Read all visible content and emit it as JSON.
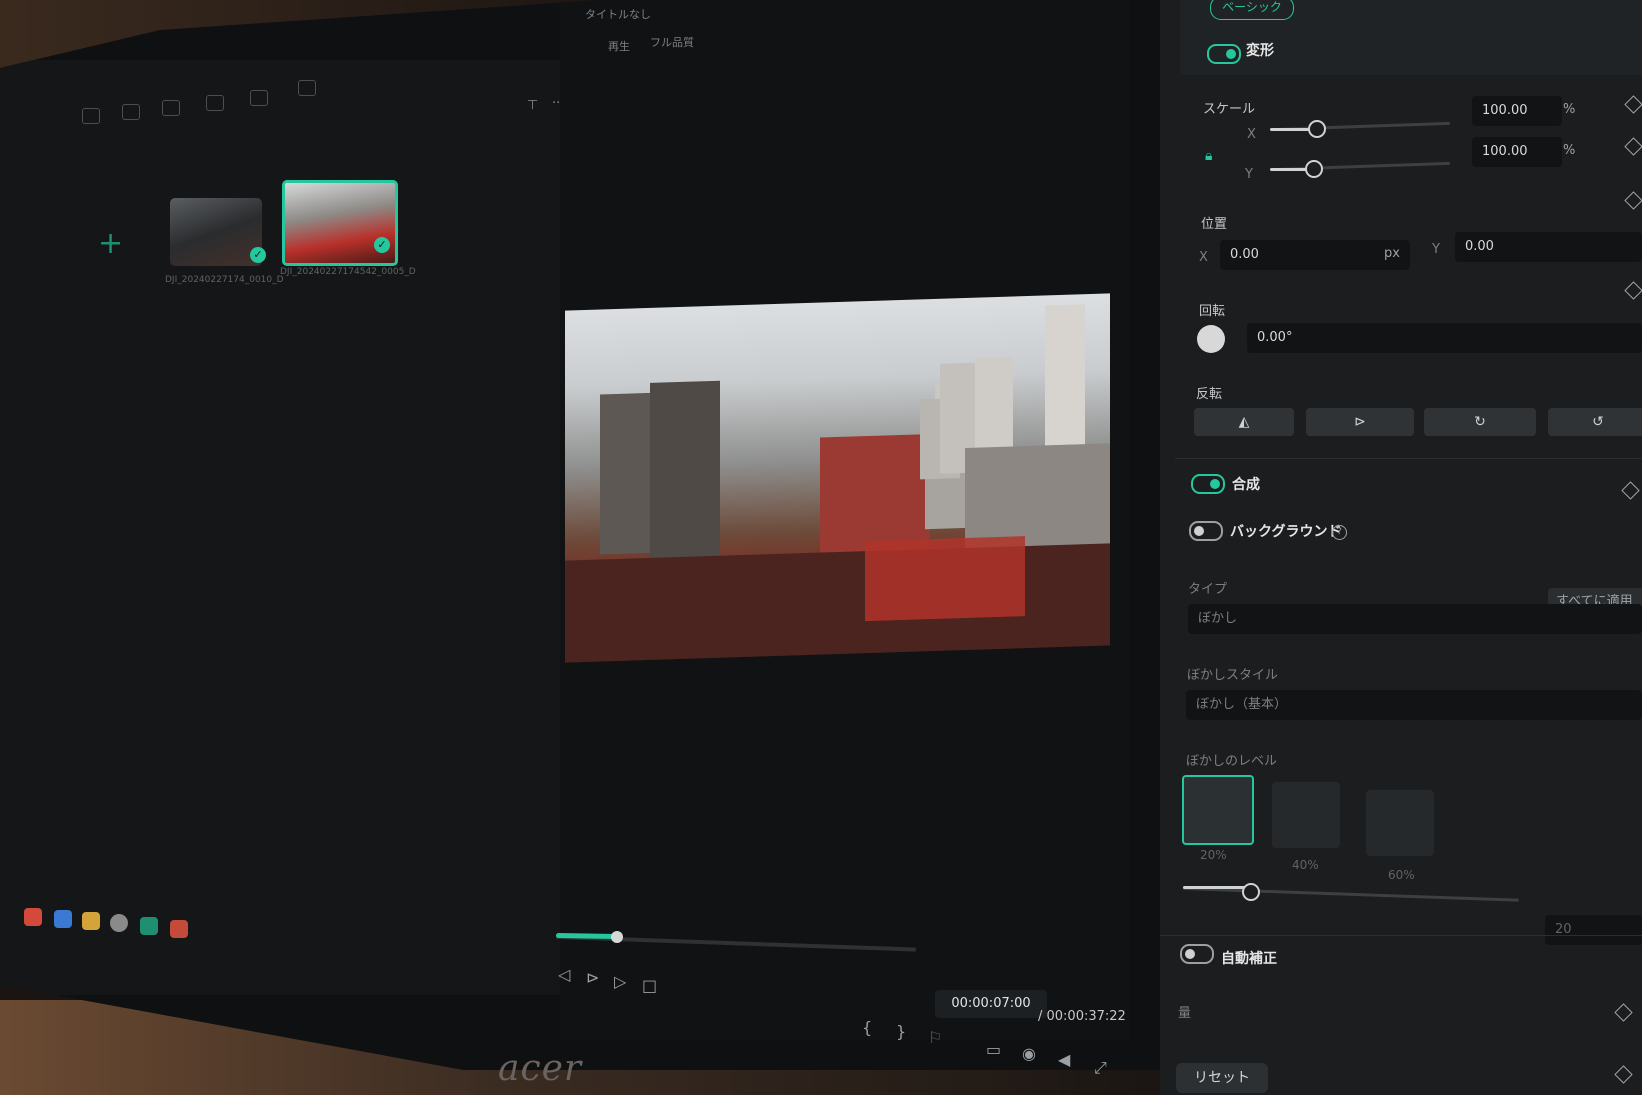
{
  "window": {
    "title": "タイトルなし"
  },
  "preview": {
    "tabs": [
      "再生",
      "フル品質"
    ],
    "current_time": "00:00:07:00",
    "total_time": "/ 00:00:37:22",
    "progress": 0.19
  },
  "media": {
    "clips": [
      {
        "label": "DJI_20240227174_0010_D"
      },
      {
        "label": "DJI_20240227174542_0005_D"
      }
    ]
  },
  "monitor": {
    "brand": "acer"
  },
  "inspector": {
    "tab_basic": "ベーシック",
    "transform": {
      "title": "変形",
      "scale": {
        "title": "スケール",
        "x_label": "X",
        "y_label": "Y",
        "x_value": "100.00",
        "y_value": "100.00",
        "unit": "%"
      },
      "position": {
        "title": "位置",
        "x_label": "X",
        "x_value": "0.00",
        "x_unit": "px",
        "y_label": "Y",
        "y_value": "0.00"
      },
      "rotation": {
        "title": "回転",
        "value": "0.00°"
      },
      "flip": {
        "title": "反転"
      }
    },
    "compositing": {
      "title": "合成"
    },
    "background": {
      "title": "バックグラウンド",
      "type_label": "タイプ",
      "type_value": "ぼかし",
      "apply_all": "すべてに適用",
      "blur_style_label": "ぼかしスタイル",
      "blur_style_value": "ぼかし（基本）",
      "blur_level_label": "ぼかしのレベル",
      "levels": [
        "20%",
        "40%",
        "60%"
      ],
      "level_value": "20"
    },
    "auto_enhance": {
      "title": "自動補正",
      "amount_label": "量"
    },
    "reset_label": "リセット"
  }
}
